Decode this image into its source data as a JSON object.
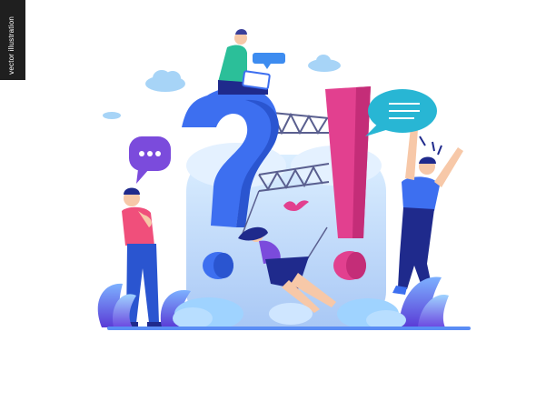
{
  "side_tab": {
    "label": "vector illustration"
  },
  "palette": {
    "question_mark": "#3d6ff0",
    "exclamation_mark": "#e2408f",
    "speech_bubble_teal": "#28b6d4",
    "speech_bubble_purple": "#7b4bdc",
    "mist": "#cfe6ff",
    "figure_dark_blue": "#1f2a8c",
    "figure_pink": "#f04f7b"
  }
}
